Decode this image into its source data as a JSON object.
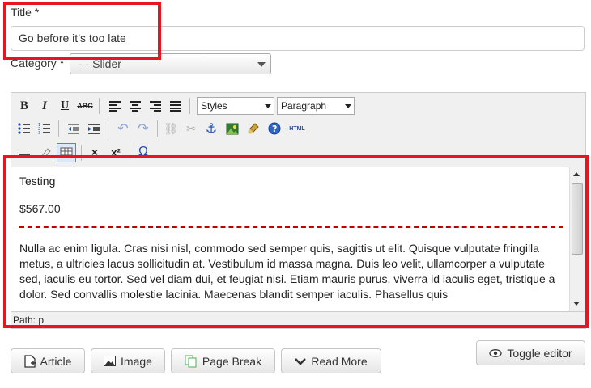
{
  "form": {
    "title_label": "Title *",
    "title_value": "Go before it’s too late",
    "category_label": "Category *",
    "category_value": "- - Slider"
  },
  "toolbar": {
    "styles_label": "Styles",
    "format_label": "Paragraph",
    "html_label": "HTML"
  },
  "content": {
    "line1": "Testing",
    "line2": "$567.00",
    "paragraph": "Nulla ac enim ligula. Cras nisi nisl, commodo sed semper quis, sagittis ut elit. Quisque vulputate fringilla metus, a ultricies lacus sollicitudin at. Vestibulum id massa magna. Duis leo velit, ullamcorper a vulputate sed, iaculis eu tortor. Sed vel diam dui, et feugiat nisi. Etiam mauris purus, viverra id iaculis eget, tristique a dolor. Sed convallis molestie lacinia. Maecenas blandit semper iaculis. Phasellus quis"
  },
  "statusbar": {
    "path": "Path: p"
  },
  "buttons": {
    "article": "Article",
    "image": "Image",
    "page_break": "Page Break",
    "read_more": "Read More",
    "toggle_editor": "Toggle editor"
  },
  "colors": {
    "highlight": "#e8141f",
    "separator": "#c00000"
  }
}
